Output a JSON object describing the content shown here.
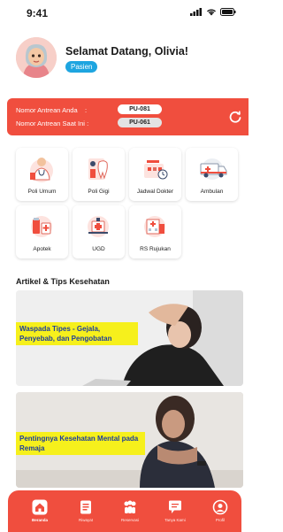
{
  "status_bar": {
    "time": "9:41"
  },
  "header": {
    "greeting": "Selamat Datang, Olivia!",
    "role": "Pasien"
  },
  "queue": {
    "your_label": "Nomor Antrean Anda",
    "your_number": "PU-081",
    "current_label": "Nomor Antrean Saat Ini",
    "current_number": "PU-061",
    "separator": ":"
  },
  "services": [
    {
      "label": "Poli Umum",
      "icon": "doctor-icon"
    },
    {
      "label": "Poli Gigi",
      "icon": "tooth-icon"
    },
    {
      "label": "Jadwal Dokter",
      "icon": "schedule-icon"
    },
    {
      "label": "Ambulan",
      "icon": "ambulance-icon"
    },
    {
      "label": "Apotek",
      "icon": "pharmacy-icon"
    },
    {
      "label": "UGD",
      "icon": "emergency-icon"
    },
    {
      "label": "RS Rujukan",
      "icon": "hospital-icon"
    }
  ],
  "articles_section": {
    "title": "Artikel & Tips Kesehatan",
    "articles": [
      {
        "caption": "Waspada Tipes - Gejala, Penyebab, dan Pengobatan"
      },
      {
        "caption": "Pentingnya Kesehatan Mental pada Remaja"
      }
    ]
  },
  "bottom_nav": [
    {
      "label": "Beranda",
      "icon": "home-icon",
      "active": true
    },
    {
      "label": "Riwayat",
      "icon": "history-icon",
      "active": false
    },
    {
      "label": "Reservasi",
      "icon": "reservation-icon",
      "active": false
    },
    {
      "label": "Tanya Kami",
      "icon": "chat-icon",
      "active": false
    },
    {
      "label": "Profil",
      "icon": "profile-icon",
      "active": false
    }
  ],
  "colors": {
    "primary": "#f04e3e",
    "badge": "#1ea5e0",
    "caption_bg": "#f6f01c",
    "caption_text": "#1d3d9c"
  }
}
